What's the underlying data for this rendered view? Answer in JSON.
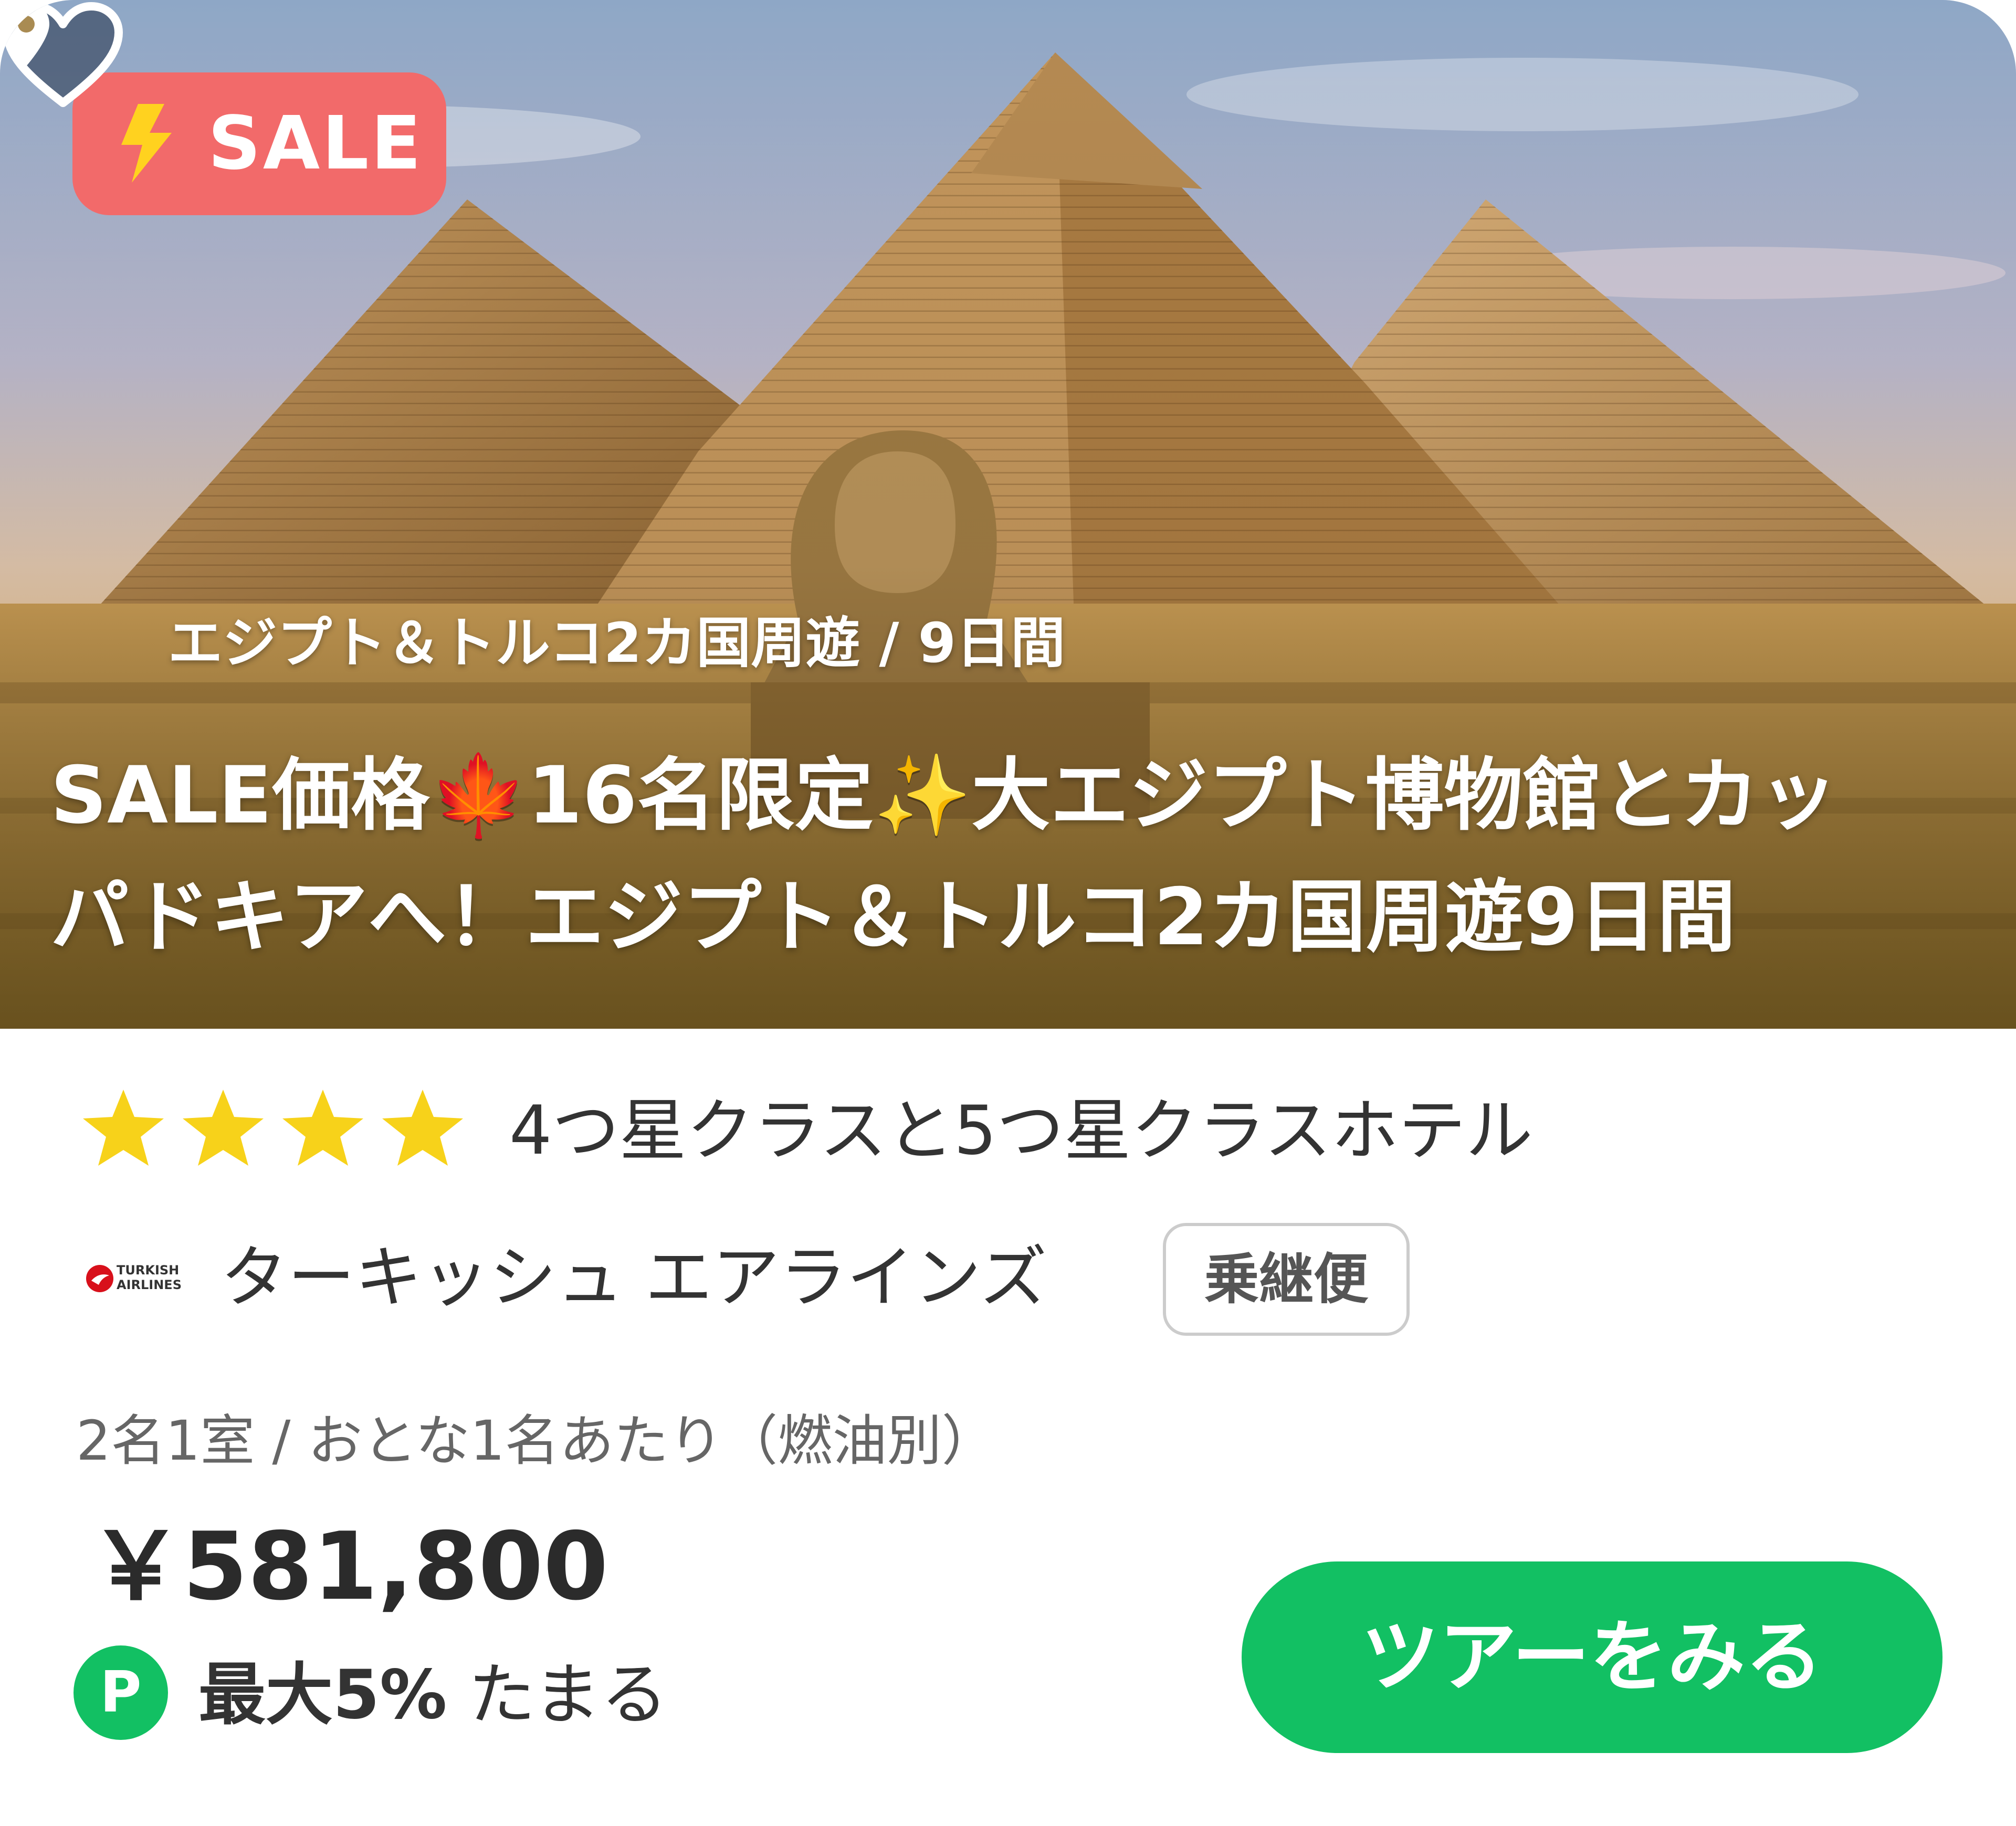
{
  "badge": {
    "label": "SALE",
    "color": "#f26a6a"
  },
  "favorite": {
    "icon": "heart-icon"
  },
  "hero": {
    "location": "エジプト＆トルコ2カ国周遊 / 9日間",
    "location_icon": "map-pin-icon"
  },
  "tour": {
    "title_line1": "SALE価格🍁16名限定✨大エジプト博物館とカッ",
    "title_line2": "パドキアへ！エジプト＆トルコ2カ国周遊9日間"
  },
  "hotel": {
    "stars": 4,
    "star_color": "#f7d21a",
    "label": "4つ星クラスと5つ星クラスホテル"
  },
  "airline": {
    "logo_line1": "TURKISH",
    "logo_line2": "AIRLINES",
    "name": "ターキッシュ エアラインズ",
    "flight_type": "乗継便"
  },
  "price": {
    "note": "2名1室 / おとな1名あたり（燃油別）",
    "amount": "￥581,800"
  },
  "points": {
    "icon_label": "P",
    "highlight": "最大5%",
    "suffix": " たまる",
    "color": "#12c063"
  },
  "cta": {
    "label": "ツアーをみる",
    "color": "#12c063"
  }
}
